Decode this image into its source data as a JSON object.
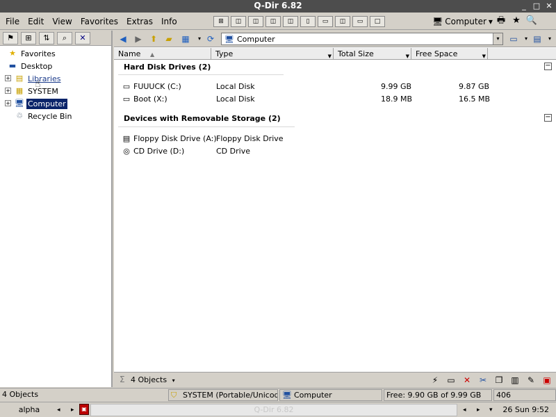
{
  "window": {
    "title": "Q-Dir 6.82",
    "ctrl_min": "_",
    "ctrl_max": "□",
    "ctrl_close": "✕"
  },
  "menu": [
    "File",
    "Edit",
    "View",
    "Favorites",
    "Extras",
    "Info"
  ],
  "toolbar": {
    "location": "Computer"
  },
  "tree": {
    "items": [
      {
        "label": "Favorites",
        "icon": "star-icon"
      },
      {
        "label": "Desktop",
        "icon": "desktop-icon"
      },
      {
        "label": "Libraries",
        "icon": "libraries-icon"
      },
      {
        "label": "SYSTEM",
        "icon": "user-folder-icon"
      },
      {
        "label": "Computer",
        "icon": "computer-icon"
      },
      {
        "label": "Recycle Bin",
        "icon": "recycle-bin-icon"
      }
    ]
  },
  "address": {
    "value": "Computer"
  },
  "columns": [
    "Name",
    "Type",
    "Total Size",
    "Free Space"
  ],
  "groups": [
    {
      "title": "Hard Disk Drives (2)",
      "rows": [
        {
          "name": "FUUUCK (C:)",
          "type": "Local Disk",
          "total": "9.99 GB",
          "free": "9.87 GB"
        },
        {
          "name": "Boot (X:)",
          "type": "Local Disk",
          "total": "18.9 MB",
          "free": "16.5 MB"
        }
      ]
    },
    {
      "title": "Devices with Removable Storage (2)",
      "rows": [
        {
          "name": "Floppy Disk Drive (A:)",
          "type": "Floppy Disk Drive",
          "total": "",
          "free": ""
        },
        {
          "name": "CD Drive (D:)",
          "type": "CD Drive",
          "total": "",
          "free": ""
        }
      ]
    }
  ],
  "panel_status": {
    "objects": "4 Objects"
  },
  "statusbar": {
    "objects": "4 Objects",
    "system": "SYSTEM (Portable/Unicode)",
    "location": "Computer",
    "free": "Free: 9.90 GB of 9.99 GB",
    "code": "406"
  },
  "taskbar": {
    "start": "alpha",
    "task": "Q-Dir 6.82",
    "clock": "26 Sun 9:52"
  },
  "colors": {
    "title_bg": "#4d4d4d",
    "selection": "#0a246a",
    "chrome": "#d4d0c8"
  }
}
